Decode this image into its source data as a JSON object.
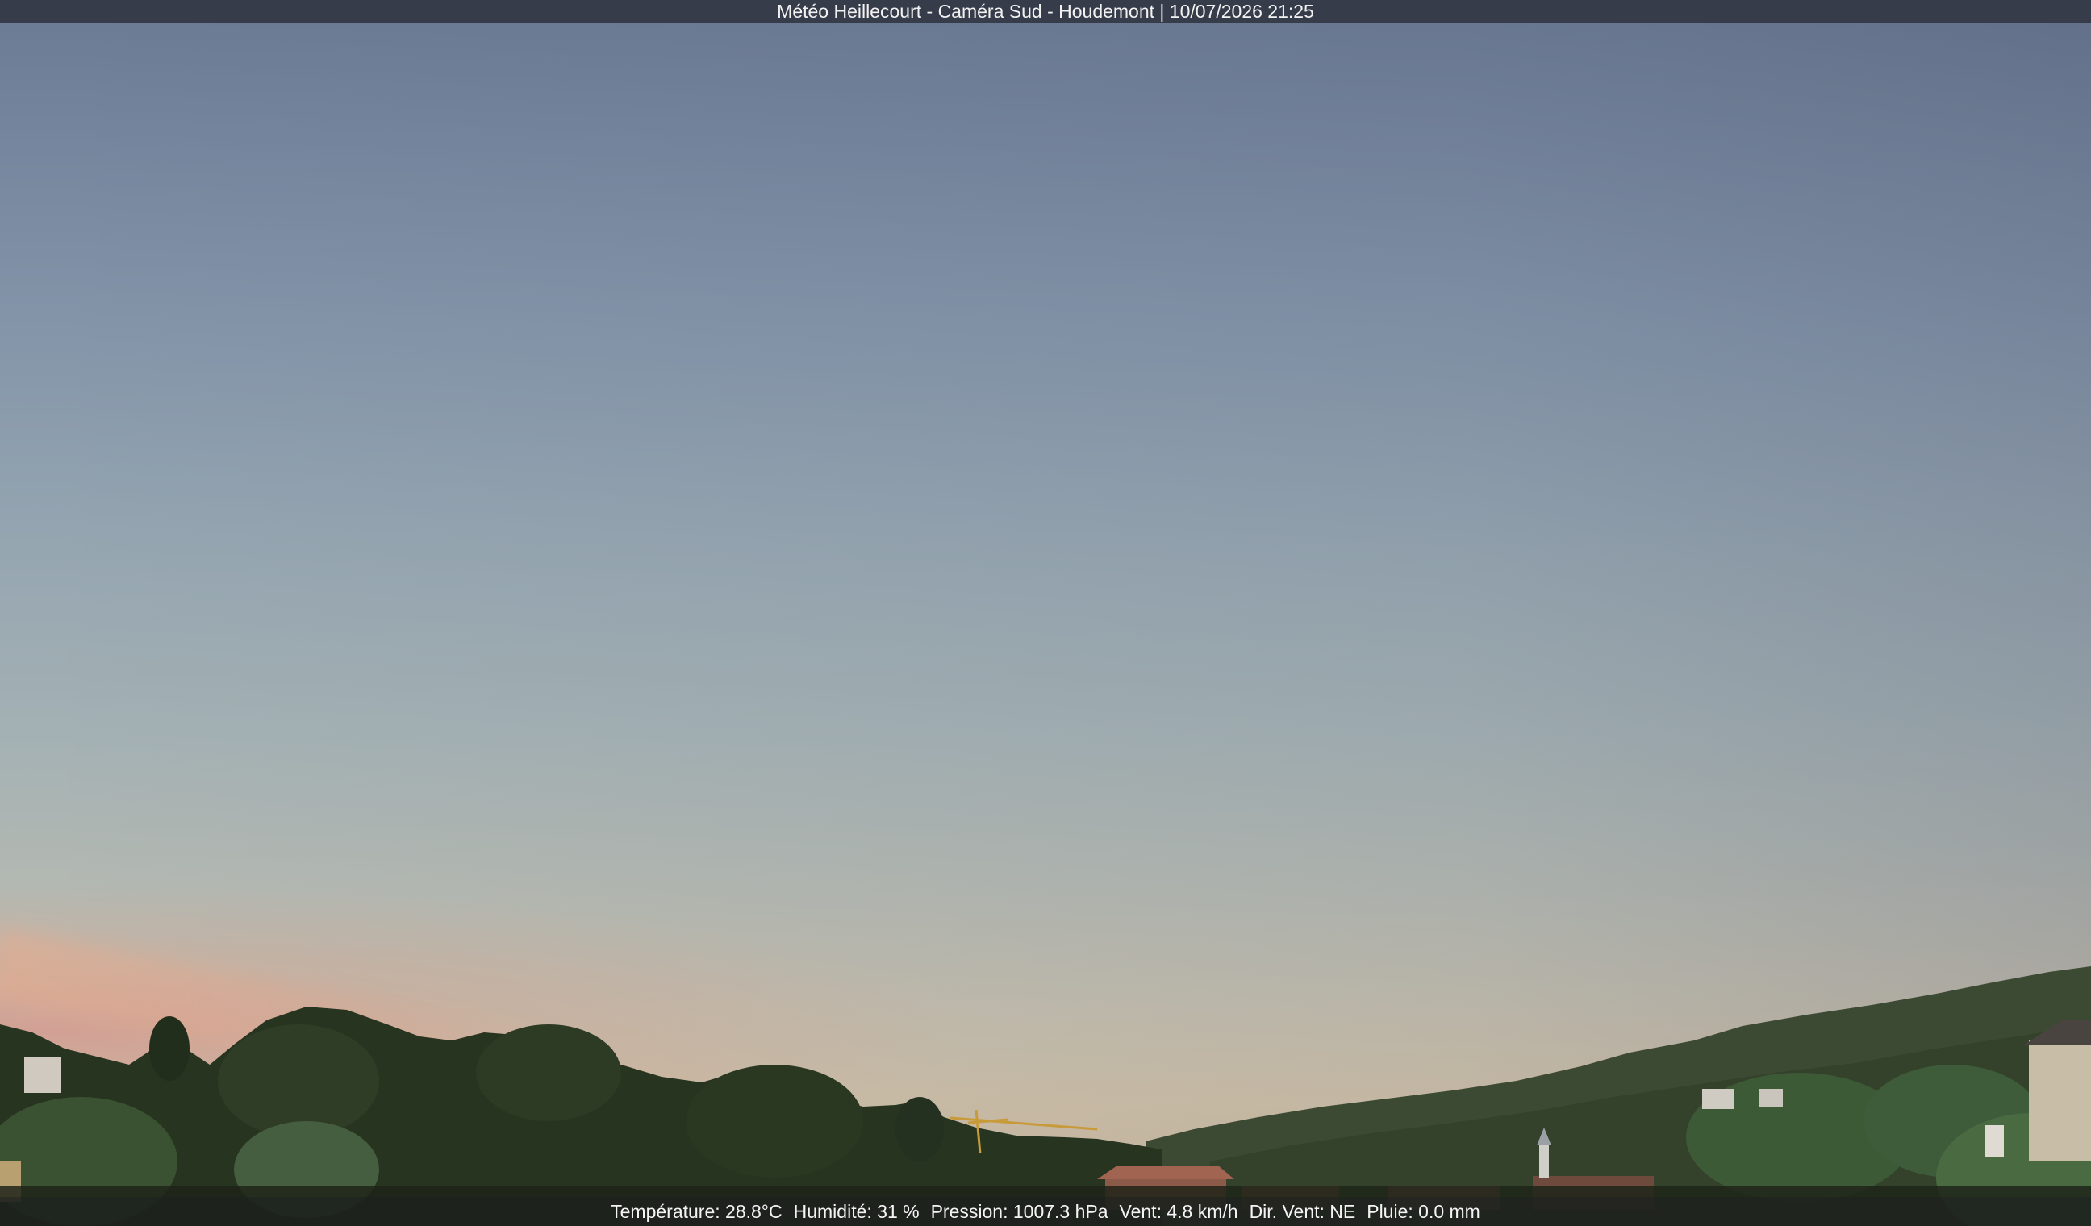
{
  "overlay": {
    "title": "Météo Heillecourt - Caméra Sud - Houdemont | 10/07/2026 21:25"
  },
  "weather": {
    "temperature": "Température: 28.8°C",
    "humidity": "Humidité: 31 %",
    "pressure": "Pression: 1007.3 hPa",
    "wind": "Vent: 4.8 km/h",
    "wind_direction": "Dir. Vent: NE",
    "rain": "Pluie: 0.0 mm"
  },
  "colors": {
    "title_bar": "#363c4a",
    "sky_top": "#6b7a93",
    "sky_horizon": "#cdbfa8",
    "sunset_glow": "#d6968c",
    "tree_dark": "#26331f"
  }
}
